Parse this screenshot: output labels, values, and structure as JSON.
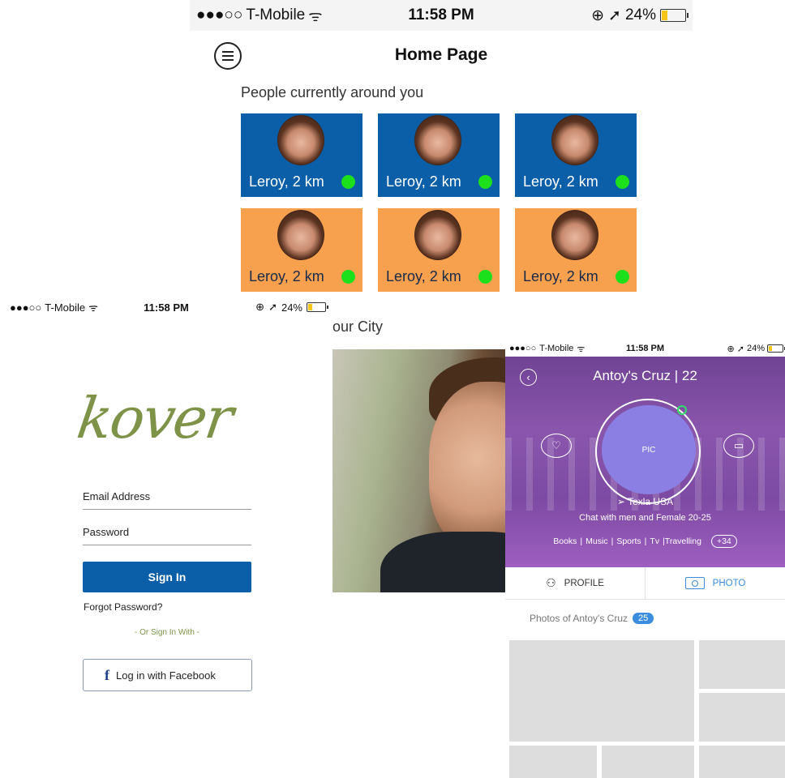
{
  "status": {
    "carrier": "T-Mobile",
    "time": "11:58 PM",
    "battery": "24%",
    "battery_level": 0.24
  },
  "home": {
    "title": "Home Page",
    "section_title": "People currently  around you",
    "cards": [
      {
        "label": "Leroy, 2 km",
        "color": "#0b5ea8"
      },
      {
        "label": "Leroy, 2 km",
        "color": "#0b5ea8"
      },
      {
        "label": "Leroy, 2 km",
        "color": "#0b5ea8"
      },
      {
        "label": "Leroy, 2 km",
        "color": "#f7a04e"
      },
      {
        "label": "Leroy, 2 km",
        "color": "#f7a04e"
      },
      {
        "label": "Leroy, 2 km",
        "color": "#f7a04e"
      }
    ],
    "city_title": "our City"
  },
  "login": {
    "logo": "kover",
    "email_placeholder": "Email Address",
    "password_placeholder": "Password",
    "signin_label": "Sign In",
    "forgot_label": "Forgot Password?",
    "or_label": "- Or Sign In With  -",
    "facebook_label": "Log in with Facebook",
    "facebook_icon": "f"
  },
  "profile": {
    "name": "Antoy's Cruz | 22",
    "pic_label": "PIC",
    "location": "Texla USA",
    "preference": "Chat with men and Female 20-25",
    "tags": [
      "Books",
      "|",
      "Music",
      "|",
      "Sports",
      "|",
      "Tv",
      "|Travelling"
    ],
    "more_tags": "+34",
    "tab_profile": "PROFILE",
    "tab_photo": "PHOTO",
    "photos_title": "Photos of Antoy's  Cruz",
    "photos_count": "25"
  }
}
